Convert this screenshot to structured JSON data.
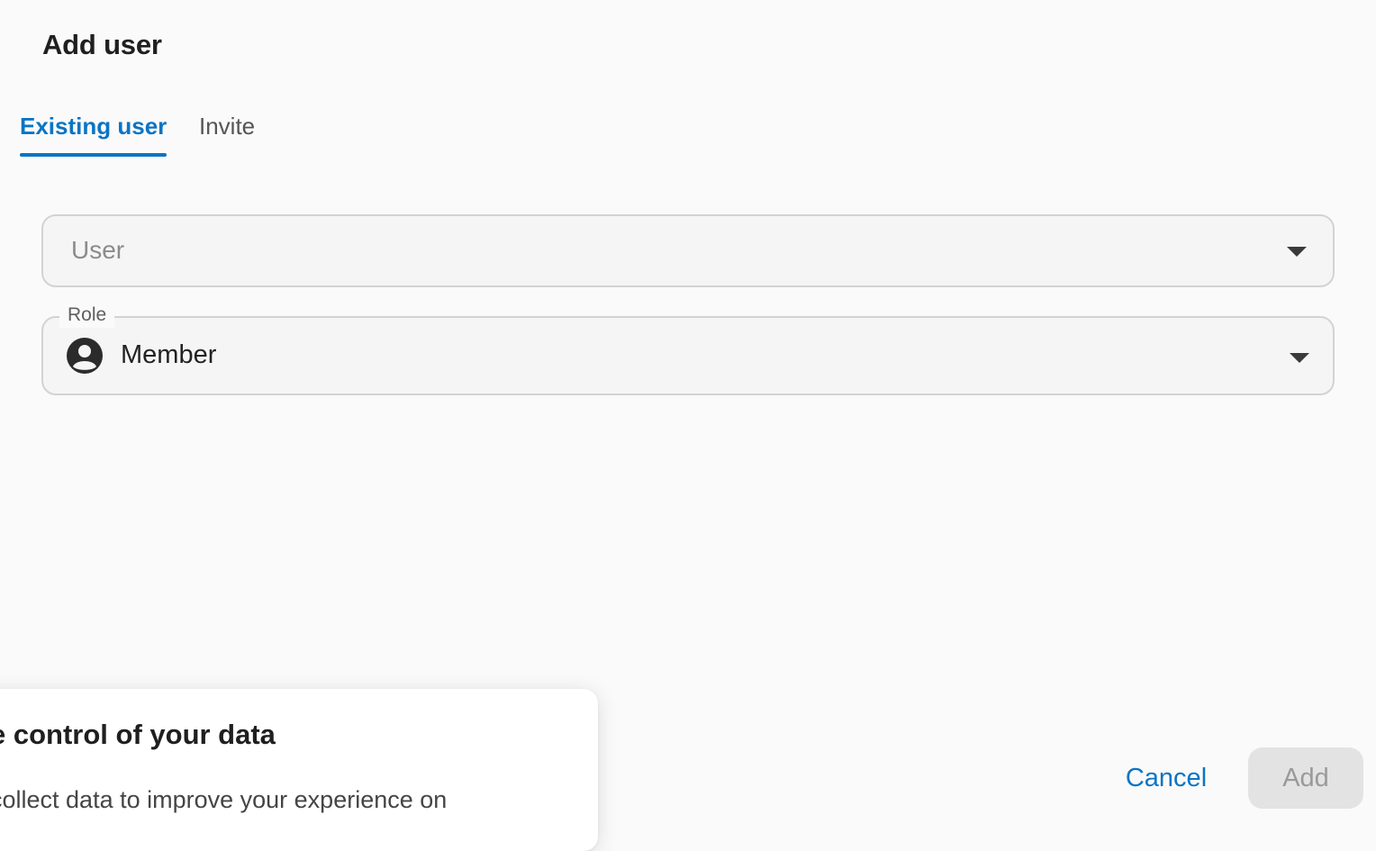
{
  "dialog": {
    "title": "Add user",
    "tabs": [
      {
        "label": "Existing user",
        "active": true
      },
      {
        "label": "Invite",
        "active": false
      }
    ],
    "user_field": {
      "placeholder": "User",
      "value": ""
    },
    "role_field": {
      "label": "Role",
      "value": "Member",
      "icon": "account-circle-icon"
    },
    "actions": {
      "cancel_label": "Cancel",
      "add_label": "Add",
      "add_enabled": false
    }
  },
  "consent_banner": {
    "title": "e control of your data",
    "body": "collect data to improve your experience on"
  },
  "colors": {
    "accent": "#0b74c4",
    "background": "#fafafa",
    "field_background": "#f5f5f5",
    "field_border": "#d3d3d3",
    "disabled_button": "#e3e3e3"
  }
}
